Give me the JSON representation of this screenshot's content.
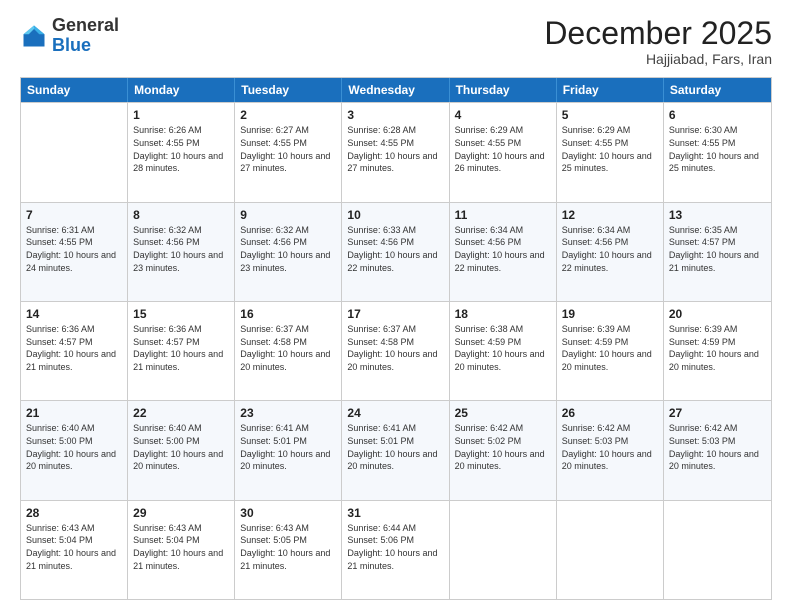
{
  "logo": {
    "general": "General",
    "blue": "Blue"
  },
  "title": "December 2025",
  "subtitle": "Hajjiabad, Fars, Iran",
  "header_days": [
    "Sunday",
    "Monday",
    "Tuesday",
    "Wednesday",
    "Thursday",
    "Friday",
    "Saturday"
  ],
  "rows": [
    [
      {
        "day": "",
        "info": ""
      },
      {
        "day": "1",
        "info": "Sunrise: 6:26 AM\nSunset: 4:55 PM\nDaylight: 10 hours and 28 minutes."
      },
      {
        "day": "2",
        "info": "Sunrise: 6:27 AM\nSunset: 4:55 PM\nDaylight: 10 hours and 27 minutes."
      },
      {
        "day": "3",
        "info": "Sunrise: 6:28 AM\nSunset: 4:55 PM\nDaylight: 10 hours and 27 minutes."
      },
      {
        "day": "4",
        "info": "Sunrise: 6:29 AM\nSunset: 4:55 PM\nDaylight: 10 hours and 26 minutes."
      },
      {
        "day": "5",
        "info": "Sunrise: 6:29 AM\nSunset: 4:55 PM\nDaylight: 10 hours and 25 minutes."
      },
      {
        "day": "6",
        "info": "Sunrise: 6:30 AM\nSunset: 4:55 PM\nDaylight: 10 hours and 25 minutes."
      }
    ],
    [
      {
        "day": "7",
        "info": "Sunrise: 6:31 AM\nSunset: 4:55 PM\nDaylight: 10 hours and 24 minutes."
      },
      {
        "day": "8",
        "info": "Sunrise: 6:32 AM\nSunset: 4:56 PM\nDaylight: 10 hours and 23 minutes."
      },
      {
        "day": "9",
        "info": "Sunrise: 6:32 AM\nSunset: 4:56 PM\nDaylight: 10 hours and 23 minutes."
      },
      {
        "day": "10",
        "info": "Sunrise: 6:33 AM\nSunset: 4:56 PM\nDaylight: 10 hours and 22 minutes."
      },
      {
        "day": "11",
        "info": "Sunrise: 6:34 AM\nSunset: 4:56 PM\nDaylight: 10 hours and 22 minutes."
      },
      {
        "day": "12",
        "info": "Sunrise: 6:34 AM\nSunset: 4:56 PM\nDaylight: 10 hours and 22 minutes."
      },
      {
        "day": "13",
        "info": "Sunrise: 6:35 AM\nSunset: 4:57 PM\nDaylight: 10 hours and 21 minutes."
      }
    ],
    [
      {
        "day": "14",
        "info": "Sunrise: 6:36 AM\nSunset: 4:57 PM\nDaylight: 10 hours and 21 minutes."
      },
      {
        "day": "15",
        "info": "Sunrise: 6:36 AM\nSunset: 4:57 PM\nDaylight: 10 hours and 21 minutes."
      },
      {
        "day": "16",
        "info": "Sunrise: 6:37 AM\nSunset: 4:58 PM\nDaylight: 10 hours and 20 minutes."
      },
      {
        "day": "17",
        "info": "Sunrise: 6:37 AM\nSunset: 4:58 PM\nDaylight: 10 hours and 20 minutes."
      },
      {
        "day": "18",
        "info": "Sunrise: 6:38 AM\nSunset: 4:59 PM\nDaylight: 10 hours and 20 minutes."
      },
      {
        "day": "19",
        "info": "Sunrise: 6:39 AM\nSunset: 4:59 PM\nDaylight: 10 hours and 20 minutes."
      },
      {
        "day": "20",
        "info": "Sunrise: 6:39 AM\nSunset: 4:59 PM\nDaylight: 10 hours and 20 minutes."
      }
    ],
    [
      {
        "day": "21",
        "info": "Sunrise: 6:40 AM\nSunset: 5:00 PM\nDaylight: 10 hours and 20 minutes."
      },
      {
        "day": "22",
        "info": "Sunrise: 6:40 AM\nSunset: 5:00 PM\nDaylight: 10 hours and 20 minutes."
      },
      {
        "day": "23",
        "info": "Sunrise: 6:41 AM\nSunset: 5:01 PM\nDaylight: 10 hours and 20 minutes."
      },
      {
        "day": "24",
        "info": "Sunrise: 6:41 AM\nSunset: 5:01 PM\nDaylight: 10 hours and 20 minutes."
      },
      {
        "day": "25",
        "info": "Sunrise: 6:42 AM\nSunset: 5:02 PM\nDaylight: 10 hours and 20 minutes."
      },
      {
        "day": "26",
        "info": "Sunrise: 6:42 AM\nSunset: 5:03 PM\nDaylight: 10 hours and 20 minutes."
      },
      {
        "day": "27",
        "info": "Sunrise: 6:42 AM\nSunset: 5:03 PM\nDaylight: 10 hours and 20 minutes."
      }
    ],
    [
      {
        "day": "28",
        "info": "Sunrise: 6:43 AM\nSunset: 5:04 PM\nDaylight: 10 hours and 21 minutes."
      },
      {
        "day": "29",
        "info": "Sunrise: 6:43 AM\nSunset: 5:04 PM\nDaylight: 10 hours and 21 minutes."
      },
      {
        "day": "30",
        "info": "Sunrise: 6:43 AM\nSunset: 5:05 PM\nDaylight: 10 hours and 21 minutes."
      },
      {
        "day": "31",
        "info": "Sunrise: 6:44 AM\nSunset: 5:06 PM\nDaylight: 10 hours and 21 minutes."
      },
      {
        "day": "",
        "info": ""
      },
      {
        "day": "",
        "info": ""
      },
      {
        "day": "",
        "info": ""
      }
    ]
  ]
}
